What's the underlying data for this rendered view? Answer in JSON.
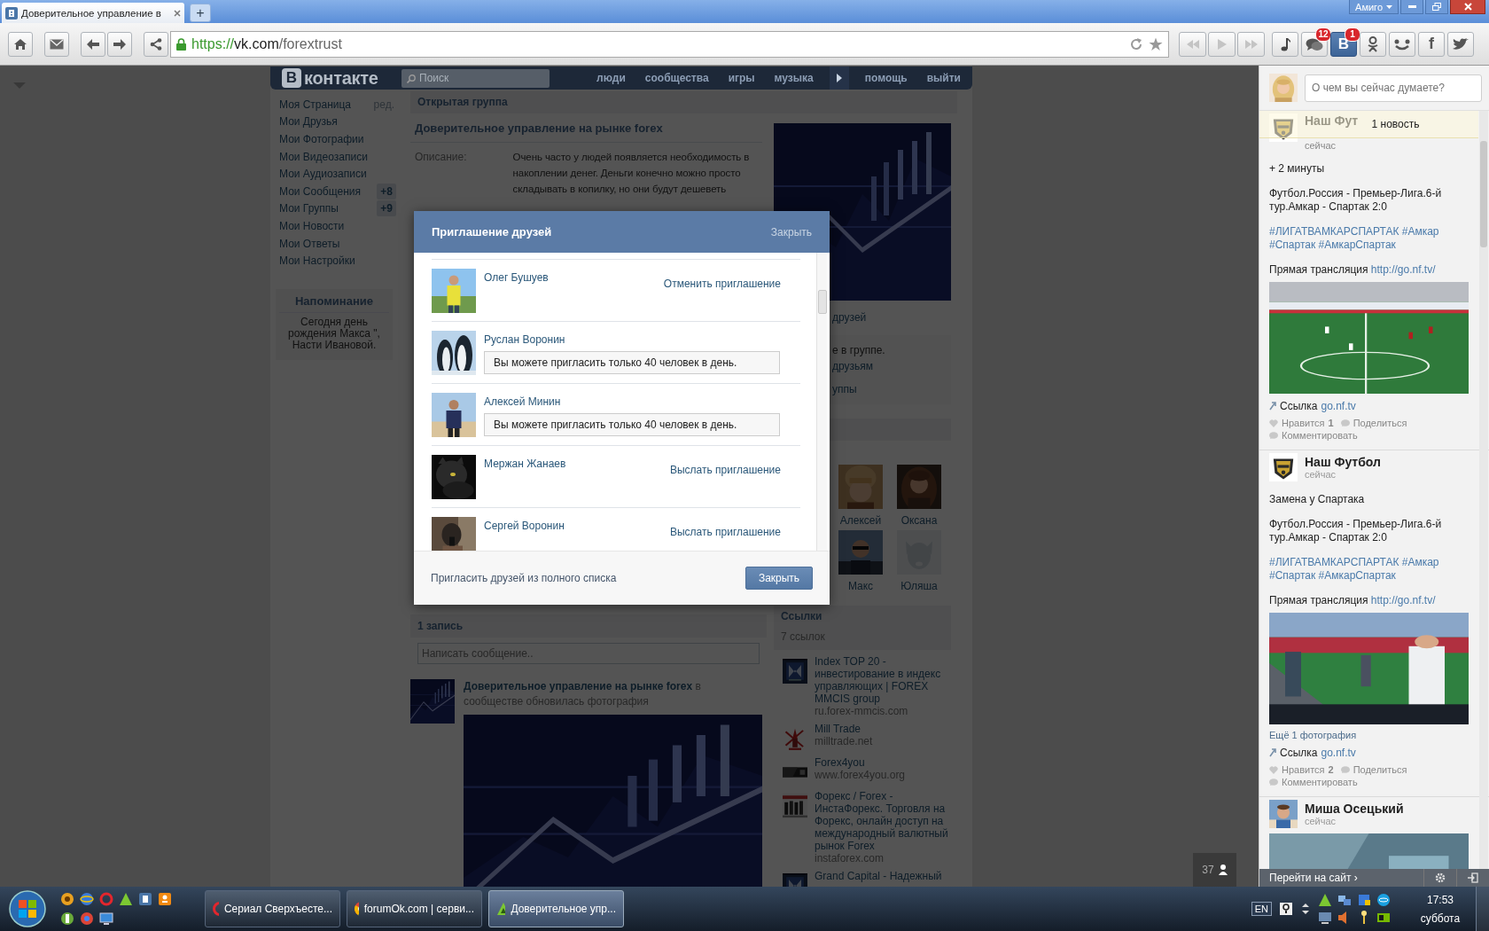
{
  "browser": {
    "tabs": [
      {
        "title": "Доверительное управление в",
        "selected": true
      }
    ],
    "new_tab": "+",
    "profile": "Амиго",
    "address": {
      "scheme": "https://",
      "host": "vk.com",
      "path": "/forextrust"
    },
    "social_buttons": [
      {
        "kind": "music"
      },
      {
        "kind": "chat",
        "badge": "12"
      },
      {
        "kind": "vk",
        "glyph": "В",
        "badge": "1"
      },
      {
        "kind": "ok"
      },
      {
        "kind": "friends"
      },
      {
        "kind": "facebook",
        "glyph": "f"
      },
      {
        "kind": "twitter"
      }
    ]
  },
  "vk": {
    "logo": {
      "letter": "В",
      "text": "контакте"
    },
    "search": {
      "placeholder": "Поиск"
    },
    "nav": [
      "люди",
      "сообщества",
      "игры",
      "музыка",
      "помощь",
      "выйти"
    ],
    "menu": [
      {
        "label": "Моя Страница",
        "extra": "ред."
      },
      {
        "label": "Мои Друзья"
      },
      {
        "label": "Мои Фотографии"
      },
      {
        "label": "Мои Видеозаписи"
      },
      {
        "label": "Мои Аудиозаписи"
      },
      {
        "label": "Мои Сообщения",
        "count": "+8"
      },
      {
        "label": "Мои Группы",
        "count": "+9"
      },
      {
        "label": "Мои Новости"
      },
      {
        "label": "Мои Ответы"
      },
      {
        "label": "Мои Настройки"
      }
    ],
    "reminder": {
      "title": "Напоминание",
      "text": "Сегодня день рождения Макса \", Насти Ивановой."
    },
    "group": {
      "type": "Открытая группа",
      "title": "Доверительное управление на рынке forex",
      "description_label": "Описание:",
      "description": "Очень часто у людей появляется необходимость в накоплении денег. Деньги конечно можно просто складывать в копилку, но они будут дешеветь",
      "invite_fragment": "друзей",
      "info_fragments": [
        "е в группе.",
        "друзьям",
        "уппы"
      ],
      "members": [
        {
          "name": "Алексей"
        },
        {
          "name": "Оксана"
        },
        {
          "name": "Макс"
        },
        {
          "name": "Юляша",
          "kind": "default"
        }
      ]
    },
    "wall": {
      "count": "1 запись",
      "placeholder": "Написать сообщение..",
      "post": {
        "author": "Доверительное управление на рынке forex",
        "text": " в сообществе обновилась фотография"
      }
    },
    "links": {
      "title": "Ссылки",
      "count": "7 ссылок",
      "items": [
        {
          "title": "Index TOP 20 - инвестирование в индекс управляющих | FOREX MMCIS group",
          "url": "ru.forex-mmcis.com"
        },
        {
          "title": "Mill Trade",
          "url": "milltrade.net"
        },
        {
          "title": "Forex4you",
          "url": "www.forex4you.org"
        },
        {
          "title": "Форекс / Forex - ИнстаФорекс. Торговля на Форекс, онлайн доступ на международный валютный рынок Forex",
          "url": "instaforex.com"
        },
        {
          "title": "Grand Capital - Надежный"
        }
      ]
    },
    "feed_counter": "37"
  },
  "modal": {
    "title": "Приглашение друзей",
    "close_link": "Закрыть",
    "rows": [
      {
        "name": "Олег Бушуев",
        "kind": "link",
        "action": "Отменить приглашение"
      },
      {
        "name": "Руслан Воронин",
        "kind": "notice",
        "action": "Вы можете пригласить только 40 человек в день."
      },
      {
        "name": "Алексей Минин",
        "kind": "notice",
        "action": "Вы можете пригласить только 40 человек в день."
      },
      {
        "name": "Мержан Жанаев",
        "kind": "link",
        "action": "Выслать приглашение"
      },
      {
        "name": "Сергей Воронин",
        "kind": "link",
        "action": "Выслать приглашение"
      }
    ],
    "full_list_link": "Пригласить друзей из полного списка",
    "close_button": "Закрыть"
  },
  "social_panel": {
    "status_placeholder": "О чем вы сейчас думаете?",
    "banner": "1 новость",
    "posts": [
      {
        "author": "Наш Фут",
        "time": "сейчас",
        "paragraphs": [
          {
            "kind": "text",
            "text": "+ 2 минуты"
          },
          {
            "kind": "text",
            "text": "Футбол.Россия - Премьер-Лига.6-й тур.Амкар - Спартак 2:0"
          },
          {
            "kind": "tags",
            "text": "#ЛИГАТВАМКАРСПАРТАК #Амкар #Спартак #АмкарСпартак"
          },
          {
            "kind": "link_line",
            "text": "Прямая трансляция ",
            "link": "http://go.nf.tv/"
          }
        ],
        "source": {
          "label": "Ссылка",
          "link": "go.nf.tv"
        },
        "likes": {
          "label": "Нравится",
          "count": "1"
        },
        "share": "Поделиться",
        "comment": "Комментировать"
      },
      {
        "author": "Наш Футбол",
        "time": "сейчас",
        "paragraphs": [
          {
            "kind": "text",
            "text": "Замена у Спартака"
          },
          {
            "kind": "text",
            "text": "Футбол.Россия - Премьер-Лига.6-й тур.Амкар - Спартак 2:0"
          },
          {
            "kind": "tags",
            "text": "#ЛИГАТВАМКАРСПАРТАК #Амкар #Спартак #АмкарСпартак"
          },
          {
            "kind": "link_line",
            "text": "Прямая трансляция ",
            "link": "http://go.nf.tv/"
          }
        ],
        "more_photos": "Ещё 1 фотография",
        "source": {
          "label": "Ссылка",
          "link": "go.nf.tv"
        },
        "likes": {
          "label": "Нравится",
          "count": "2"
        },
        "share": "Поделиться",
        "comment": "Комментировать"
      },
      {
        "author": "Миша Осецький",
        "time": "сейчас"
      }
    ],
    "go_to_site": "Перейти на сайт ›"
  },
  "taskbar": {
    "tasks": [
      {
        "title": "Сериал Сверхъесте...",
        "kind": "opera",
        "selected": false
      },
      {
        "title": "forumOk.com | серви...",
        "kind": "chrome",
        "selected": false
      },
      {
        "title": "Доверительное упр...",
        "kind": "amigo",
        "selected": true
      }
    ],
    "language": "EN",
    "time": "17:53",
    "day": "суббота"
  }
}
